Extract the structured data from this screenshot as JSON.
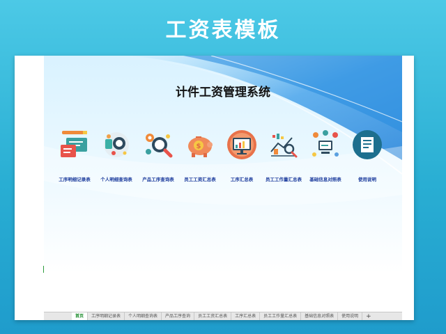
{
  "banner": {
    "title": "工资表模板"
  },
  "sheet": {
    "system_title": "计件工资管理系统",
    "modules": [
      {
        "label": "工序明细记录表",
        "icon": "chat-pencil-icon"
      },
      {
        "label": "个人明细查询表",
        "icon": "user-search-icon"
      },
      {
        "label": "产品工序查询表",
        "icon": "gear-magnifier-icon"
      },
      {
        "label": "员工工资汇总表",
        "icon": "piggy-bank-icon"
      },
      {
        "label": "工序汇总表",
        "icon": "monitor-chart-icon"
      },
      {
        "label": "员工工作量汇总表",
        "icon": "chart-magnifier-icon"
      },
      {
        "label": "基础信息对照表",
        "icon": "network-screen-icon"
      },
      {
        "label": "使用说明",
        "icon": "document-icon"
      }
    ]
  },
  "tabs": [
    {
      "label": "首页",
      "active": true
    },
    {
      "label": "工序明细记录表"
    },
    {
      "label": "个人明细查询表"
    },
    {
      "label": "产品工序查询"
    },
    {
      "label": "员工工资汇总表"
    },
    {
      "label": "工序汇总表"
    },
    {
      "label": "员工工作量汇总表"
    },
    {
      "label": "基础信息对照表"
    },
    {
      "label": "使用说明"
    },
    {
      "label": "+"
    }
  ],
  "colors": {
    "background": "#29aed3",
    "label_blue": "#1a3a9c",
    "active_tab": "#1a8a2a"
  }
}
